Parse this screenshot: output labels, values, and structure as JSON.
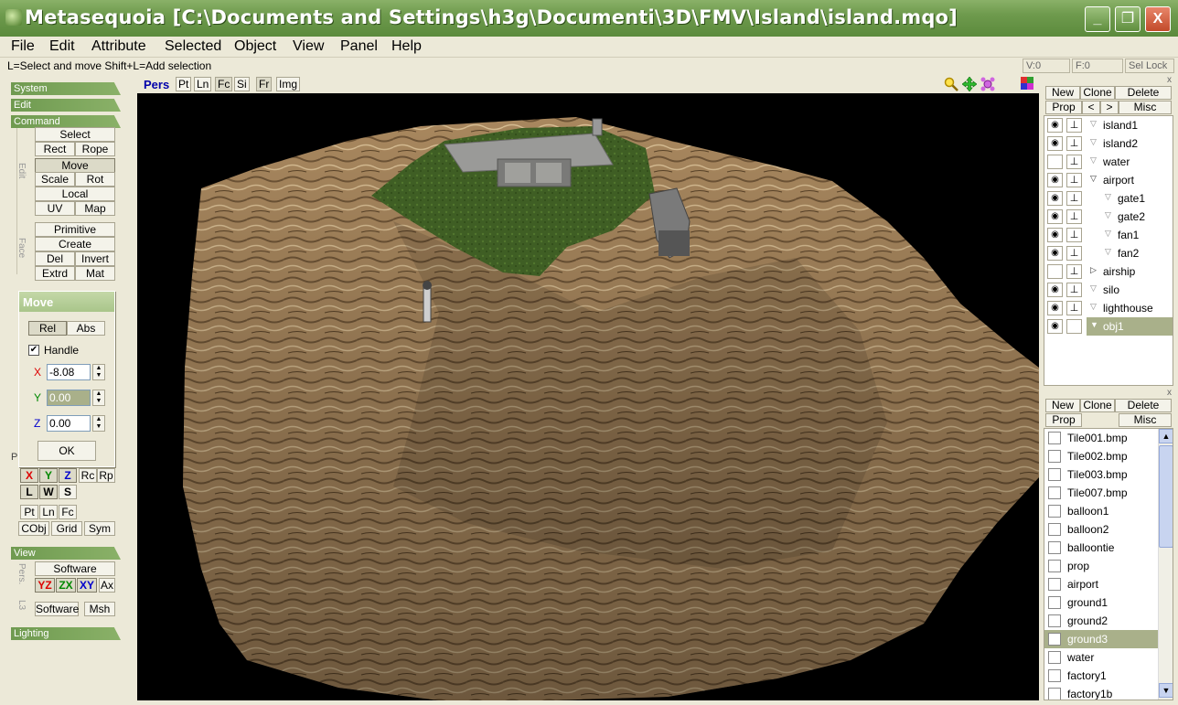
{
  "window": {
    "title": "Metasequoia [C:\\Documents and Settings\\h3g\\Documenti\\3D\\FMV\\Island\\island.mqo]",
    "minimize": "_",
    "maximize": "❐",
    "close": "X"
  },
  "menu": [
    "File",
    "Edit",
    "Attribute",
    "Selected",
    "Object",
    "View",
    "Panel",
    "Help"
  ],
  "status": {
    "hint": "L=Select and move  Shift+L=Add selection",
    "vertices": "V:0",
    "faces": "F:0",
    "sel_lock": "Sel Lock"
  },
  "left": {
    "sections": {
      "system": "System",
      "edit": "Edit",
      "command": "Command",
      "view": "View",
      "lighting": "Lighting"
    },
    "edit_group_label": "Edit",
    "face_group_label": "Face",
    "pers_group_label": "Pers.",
    "l3_label": "L3",
    "commands": {
      "select": "Select",
      "rect": "Rect",
      "rope": "Rope",
      "move": "Move",
      "scale": "Scale",
      "rot": "Rot",
      "local": "Local",
      "uv": "UV",
      "map": "Map",
      "primitive": "Primitive",
      "create": "Create",
      "del": "Del",
      "invert": "Invert",
      "extrd": "Extrd",
      "mat": "Mat"
    },
    "axis_buttons": {
      "p_label": "P",
      "x": "X",
      "y": "Y",
      "z": "Z",
      "rc": "Rc",
      "rp": "Rp",
      "l": "L",
      "w": "W",
      "s": "S",
      "pt": "Pt",
      "ln": "Ln",
      "fc": "Fc",
      "cobj": "CObj",
      "grid": "Grid",
      "sym": "Sym"
    },
    "view_buttons": {
      "software": "Software",
      "yz": "YZ",
      "zx": "ZX",
      "xy": "XY",
      "ax": "Ax",
      "software2": "Software",
      "msh": "Msh"
    }
  },
  "move_dialog": {
    "title": "Move",
    "rel": "Rel",
    "abs": "Abs",
    "handle_label": "Handle",
    "handle_checked": "✔",
    "x_label": "X",
    "y_label": "Y",
    "z_label": "Z",
    "x_value": "-8.08",
    "y_value": "0.00",
    "z_value": "0.00",
    "ok": "OK"
  },
  "viewport": {
    "toolbar": [
      "Pers",
      "Pt",
      "Ln",
      "Fc",
      "Si",
      "Fr",
      "Img"
    ]
  },
  "objects_panel": {
    "buttons": {
      "new": "New",
      "clone": "Clone",
      "delete": "Delete",
      "prop": "Prop",
      "prev": "<",
      "next": ">",
      "misc": "Misc"
    },
    "close": "x",
    "items": [
      {
        "name": "island1",
        "visible": "◉",
        "tri": "▽"
      },
      {
        "name": "island2",
        "visible": "◉",
        "tri": "▽"
      },
      {
        "name": "water",
        "visible": "",
        "tri": "▽"
      },
      {
        "name": "airport",
        "visible": "◉",
        "tri": "▽"
      },
      {
        "name": "gate1",
        "visible": "◉",
        "tri": "▽"
      },
      {
        "name": "gate2",
        "visible": "◉",
        "tri": "▽"
      },
      {
        "name": "fan1",
        "visible": "◉",
        "tri": "▽"
      },
      {
        "name": "fan2",
        "visible": "◉",
        "tri": "▽"
      },
      {
        "name": "airship",
        "visible": "",
        "tri": "▷"
      },
      {
        "name": "silo",
        "visible": "◉",
        "tri": "▽"
      },
      {
        "name": "lighthouse",
        "visible": "◉",
        "tri": "▽"
      },
      {
        "name": "obj1",
        "visible": "◉",
        "tri": "▼"
      }
    ]
  },
  "materials_panel": {
    "buttons": {
      "new": "New",
      "clone": "Clone",
      "delete": "Delete",
      "prop": "Prop",
      "misc": "Misc"
    },
    "close": "x",
    "items": [
      "Tile001.bmp",
      "Tile002.bmp",
      "Tile003.bmp",
      "Tile007.bmp",
      "balloon1",
      "balloon2",
      "balloontie",
      "prop",
      "airport",
      "ground1",
      "ground2",
      "ground3",
      "water",
      "factory1",
      "factory1b"
    ],
    "scroll_up": "▲",
    "scroll_down": "▼"
  }
}
